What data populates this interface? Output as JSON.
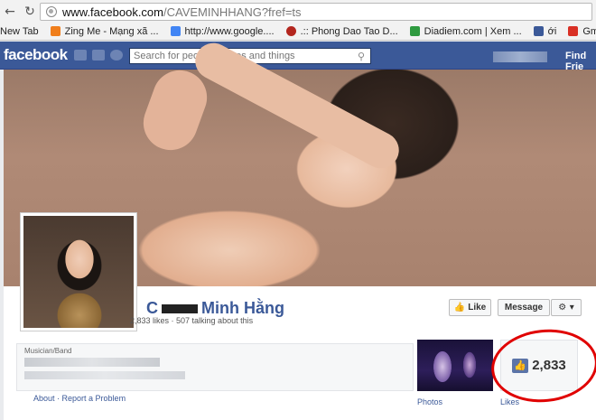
{
  "browser": {
    "url_host": "www.facebook.com",
    "url_path": "/CAVEMINHHANG?fref=ts",
    "bookmarks": [
      {
        "label": "New Tab",
        "color": "#f2f2f2",
        "icon": "none"
      },
      {
        "label": "Zing Me - Mạng xã ...",
        "color": "#f07e1b",
        "icon": "zing-icon"
      },
      {
        "label": "http://www.google....",
        "color": "#4285f4",
        "icon": "google-icon"
      },
      {
        "label": ".:: Phong Dao Tao D...",
        "color": "#b3261e",
        "icon": "school-icon"
      },
      {
        "label": "Diadiem.com | Xem ...",
        "color": "#2e9a3f",
        "icon": "diadiem-icon"
      },
      {
        "label": "ới",
        "color": "#3b5998",
        "icon": "facebook-icon"
      },
      {
        "label": "Gmail: Email từ Goo...",
        "color": "#d93025",
        "icon": "gmail-icon"
      }
    ]
  },
  "fb": {
    "logo": "facebook",
    "search_placeholder": "Search for people, places and things",
    "find_friends": "Find Frie"
  },
  "page": {
    "name_prefix": "C",
    "name_suffix": "Minh Hằng",
    "stats": "2,833 likes · 507 talking about this",
    "category": "Musician/Band",
    "like_button": "Like",
    "message_button": "Message",
    "gear_button": "⚙ ▾",
    "about_link": "About",
    "separator": " · ",
    "report_link": "Report a Problem",
    "photos_label": "Photos",
    "likes_count": "2,833",
    "likes_label": "Likes"
  },
  "colors": {
    "fb_blue": "#3b5998",
    "highlight_circle": "#e00000"
  }
}
